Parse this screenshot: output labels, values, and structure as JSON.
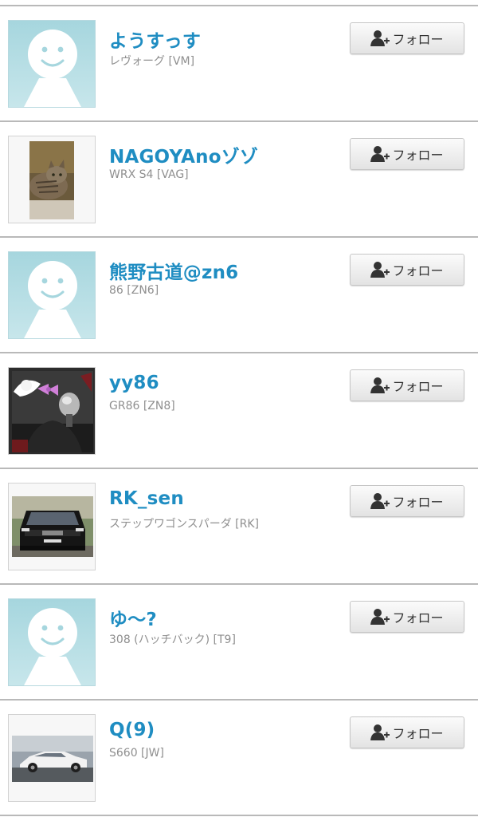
{
  "follow_label": "フォロー",
  "accent_color": "#1f8dc2",
  "users": [
    {
      "name": "ようすっす",
      "car": "レヴォーグ [VM]",
      "avatar": "default-avatar"
    },
    {
      "name": "NAGOYAnoゾゾ",
      "car": "WRX S4 [VAG]",
      "avatar": "cat-photo"
    },
    {
      "name": "熊野古道@zn6",
      "car": "86 [ZN6]",
      "avatar": "default-avatar"
    },
    {
      "name": "yy86",
      "car": "GR86 [ZN8]",
      "avatar": "shift-knob-photo"
    },
    {
      "name": "RK_sen",
      "car": "ステップワゴンスパーダ [RK]",
      "avatar": "minivan-photo"
    },
    {
      "name": "ゆ〜?",
      "car": "308 (ハッチバック) [T9]",
      "avatar": "default-avatar"
    },
    {
      "name": "Q(9)",
      "car": "S660 [JW]",
      "avatar": "white-car-photo"
    }
  ]
}
